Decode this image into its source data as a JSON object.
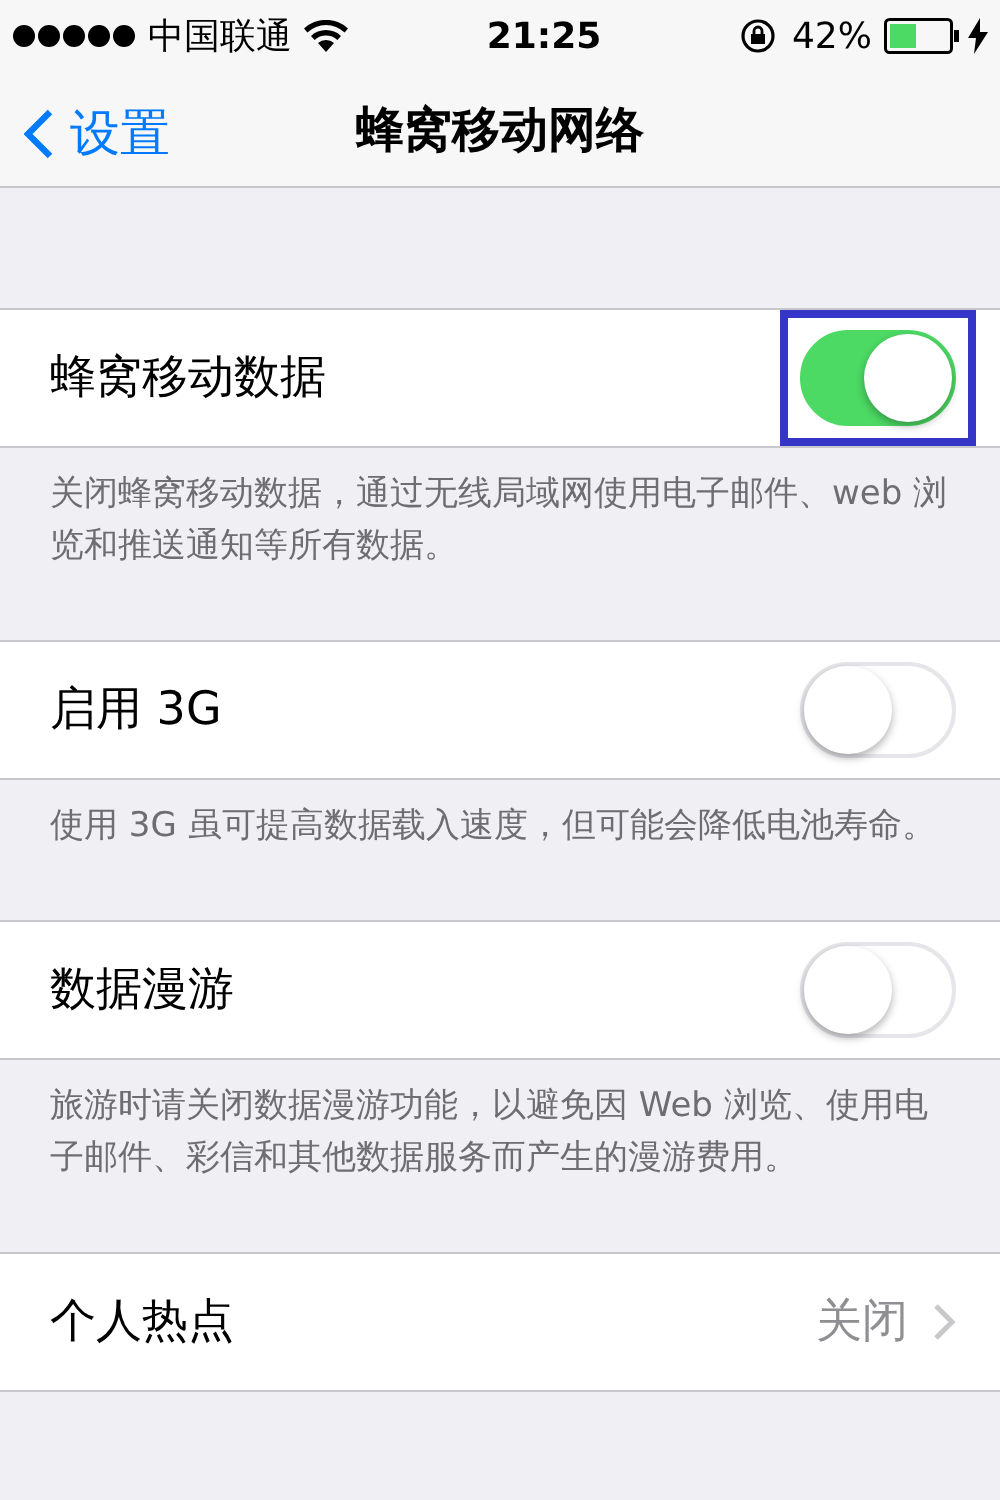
{
  "status_bar": {
    "carrier": "中国联通",
    "time": "21:25",
    "battery": "42%"
  },
  "nav": {
    "back": "设置",
    "title": "蜂窝移动网络"
  },
  "sections": [
    {
      "kind": "toggle",
      "label": "蜂窝移动数据",
      "on": true,
      "highlighted": true,
      "footer": "关闭蜂窝移动数据，通过无线局域网使用电子邮件、web 浏览和推送通知等所有数据。"
    },
    {
      "kind": "toggle",
      "label": "启用 3G",
      "on": false,
      "highlighted": false,
      "footer": "使用 3G 虽可提高数据载入速度，但可能会降低电池寿命。"
    },
    {
      "kind": "toggle",
      "label": "数据漫游",
      "on": false,
      "highlighted": false,
      "footer": "旅游时请关闭数据漫游功能，以避免因 Web 浏览、使用电子邮件、彩信和其他数据服务而产生的漫游费用。"
    },
    {
      "kind": "link",
      "label": "个人热点",
      "value": "关闭"
    }
  ]
}
